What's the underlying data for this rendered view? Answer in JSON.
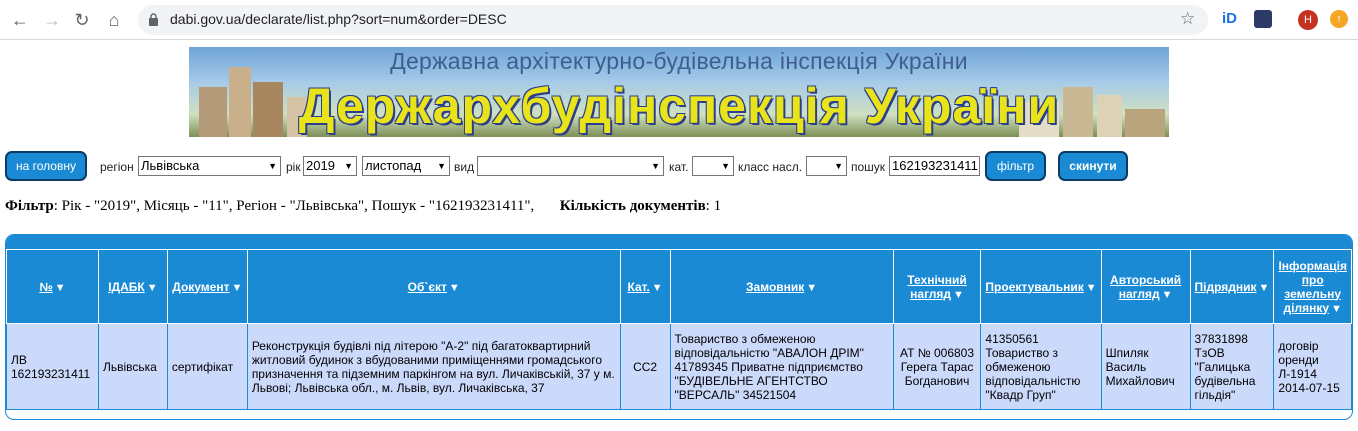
{
  "browser": {
    "url": "dabi.gov.ua/declarate/list.php?sort=num&order=DESC",
    "avatar_letter": "H"
  },
  "banner": {
    "subtitle": "Державна архітектурно-будівельна інспекція України",
    "title": "Держархбудінспекція України"
  },
  "filters": {
    "home_label": "на головну",
    "region_label": "регіон",
    "region_value": "Львівська",
    "year_label": "рік",
    "year_value": "2019",
    "month_value": "листопад",
    "type_label": "вид",
    "type_value": "",
    "cat_label": "кат.",
    "cat_value": "",
    "class_label": "класс насл.",
    "class_value": "",
    "search_label": "пошук",
    "search_value": "162193231411",
    "filter_button": "фільтр",
    "reset_button": "скинути"
  },
  "summary": {
    "filter_title": "Фільтр",
    "filter_text": ": Рік - \"2019\", Місяць - \"11\", Регіон - \"Львівська\", Пошук - \"162193231411\",",
    "count_title": "Кількість документів",
    "count_value": ": 1"
  },
  "table": {
    "headers": [
      "№",
      "ІДАБК",
      "Документ",
      "Об`єкт",
      "Кат.",
      "Замовник",
      "Технічний нагляд",
      "Проектувальник",
      "Авторський нагляд",
      "Підрядник",
      "Інформація про земельну ділянку"
    ],
    "rows": [
      {
        "num": "ЛВ 162193231411",
        "idabk": "Львівська",
        "doc": "сертифікат",
        "object": "Реконструкція будівлі під літерою \"А-2\" під багатоквартирний житловий будинок з вбудованими приміщеннями громадського призначення та підземним паркінгом на вул. Личаківській, 37 у м. Львові; Львівська обл., м. Львів, вул. Личаківська, 37",
        "cat": "СС2",
        "customer": "Товариство з обмеженою відповідальністю \"АВАЛОН ДРІМ\" 41789345 Приватне підприємство \"БУДІВЕЛЬНЕ АГЕНТСТВО \"ВЕРСАЛЬ\" 34521504",
        "tech": "АТ № 006803 Герега Тарас Богданович",
        "designer": "41350561 Товариство з обмеженою відповідальністю \"Квадр Груп\"",
        "author": "Шпиляк Василь Михайлович",
        "contractor": "37831898 ТзОВ \"Галицька будівельна гільдія\"",
        "land": "договір оренди Л-1914 2014-07-15"
      }
    ]
  }
}
